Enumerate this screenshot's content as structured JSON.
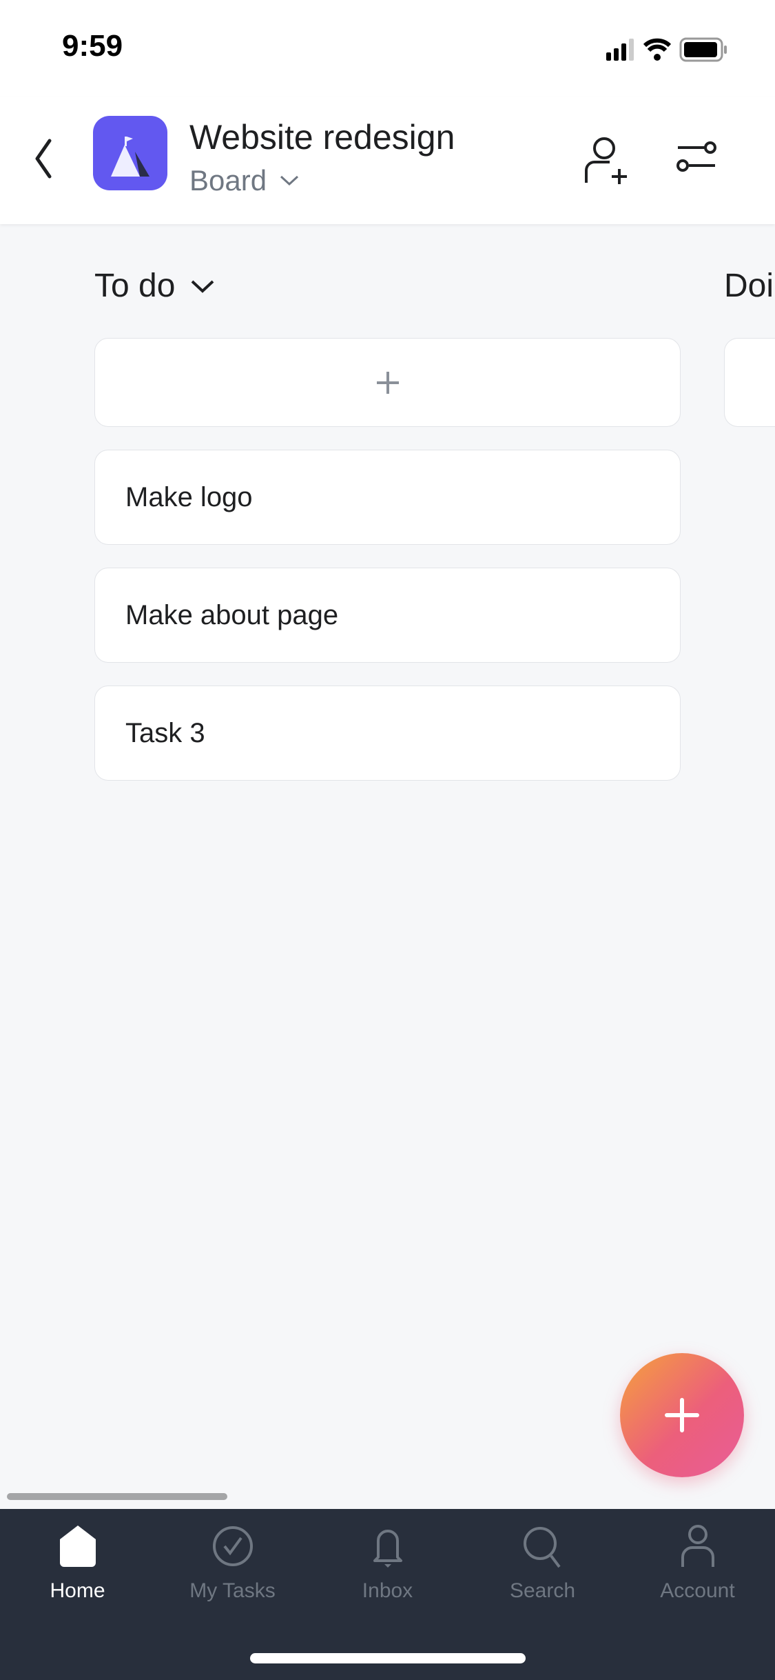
{
  "status_bar": {
    "time": "9:59"
  },
  "header": {
    "title": "Website redesign",
    "view": "Board",
    "icons": [
      "back-chevron-icon",
      "add-member-icon",
      "filter-icon"
    ],
    "project_color": "#6258f0"
  },
  "board": {
    "columns": [
      {
        "title": "To do",
        "add_icon": "plus-icon",
        "tasks": [
          {
            "name": "Make logo"
          },
          {
            "name": "Make about page"
          },
          {
            "name": "Task 3"
          }
        ]
      },
      {
        "title": "Doi"
      }
    ]
  },
  "fab": {
    "icon": "plus-icon"
  },
  "tabbar": {
    "items": [
      {
        "label": "Home",
        "icon": "home-icon",
        "active": true
      },
      {
        "label": "My Tasks",
        "icon": "check-circle-icon"
      },
      {
        "label": "Inbox",
        "icon": "bell-icon"
      },
      {
        "label": "Search",
        "icon": "search-icon"
      },
      {
        "label": "Account",
        "icon": "person-icon"
      }
    ]
  }
}
